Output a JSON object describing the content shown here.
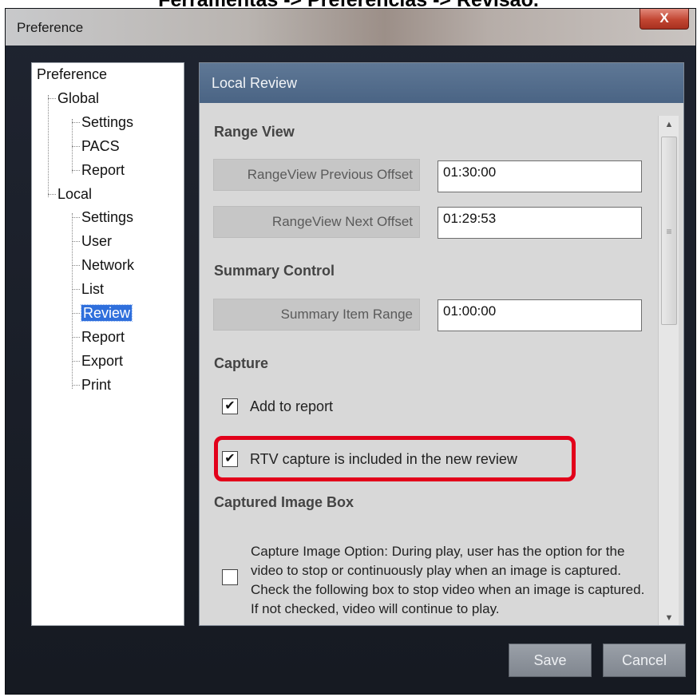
{
  "page_caption": "Ferramentas -> Preferências -> Revisão.",
  "window": {
    "title": "Preference",
    "close_label": "X"
  },
  "tree": {
    "root": "Preference",
    "global": {
      "label": "Global",
      "children": [
        "Settings",
        "PACS",
        "Report"
      ]
    },
    "local": {
      "label": "Local",
      "children": [
        "Settings",
        "User",
        "Network",
        "List",
        "Review",
        "Report",
        "Export",
        "Print"
      ]
    },
    "selected": "Review"
  },
  "content": {
    "header": "Local Review",
    "range_view": {
      "title": "Range View",
      "previous_label": "RangeView Previous Offset",
      "previous_value": "01:30:00",
      "next_label": "RangeView Next Offset",
      "next_value": "01:29:53"
    },
    "summary_control": {
      "title": "Summary Control",
      "item_range_label": "Summary Item Range",
      "item_range_value": "01:00:00"
    },
    "capture": {
      "title": "Capture",
      "add_to_report_label": "Add to report",
      "add_to_report_checked": true,
      "rtv_label": "RTV capture is included in the new review",
      "rtv_checked": true
    },
    "captured_image_box": {
      "title": "Captured Image Box",
      "option_text": "Capture Image Option: During play, user has the option for the video to stop or continuously play when an image is captured. Check the following box to stop video when an image is captured. If not checked, video will continue to play.",
      "checked": false
    }
  },
  "buttons": {
    "save": "Save",
    "cancel": "Cancel"
  },
  "colors": {
    "header_bg": "#4f6888",
    "selection": "#2f6fdc",
    "highlight": "#e2001a"
  }
}
